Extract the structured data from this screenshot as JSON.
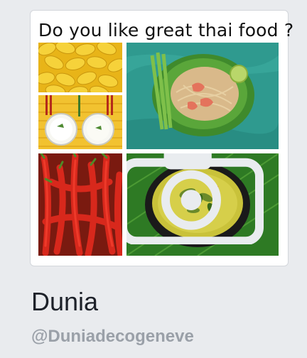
{
  "post": {
    "caption": "Do you like great thai food ?",
    "photos": [
      {
        "icon": "mango-photo"
      },
      {
        "icon": "rice-bowls-photo"
      },
      {
        "icon": "pad-thai-photo"
      },
      {
        "icon": "red-chilies-photo"
      },
      {
        "icon": "green-curry-photo"
      }
    ],
    "overlay_icon": "camera-icon"
  },
  "profile": {
    "name": "Dunia",
    "handle": "@Duniadecogeneve"
  },
  "colors": {
    "background": "#e9ebee",
    "name_text": "#1d2129",
    "handle_text": "#9aa0a8"
  }
}
